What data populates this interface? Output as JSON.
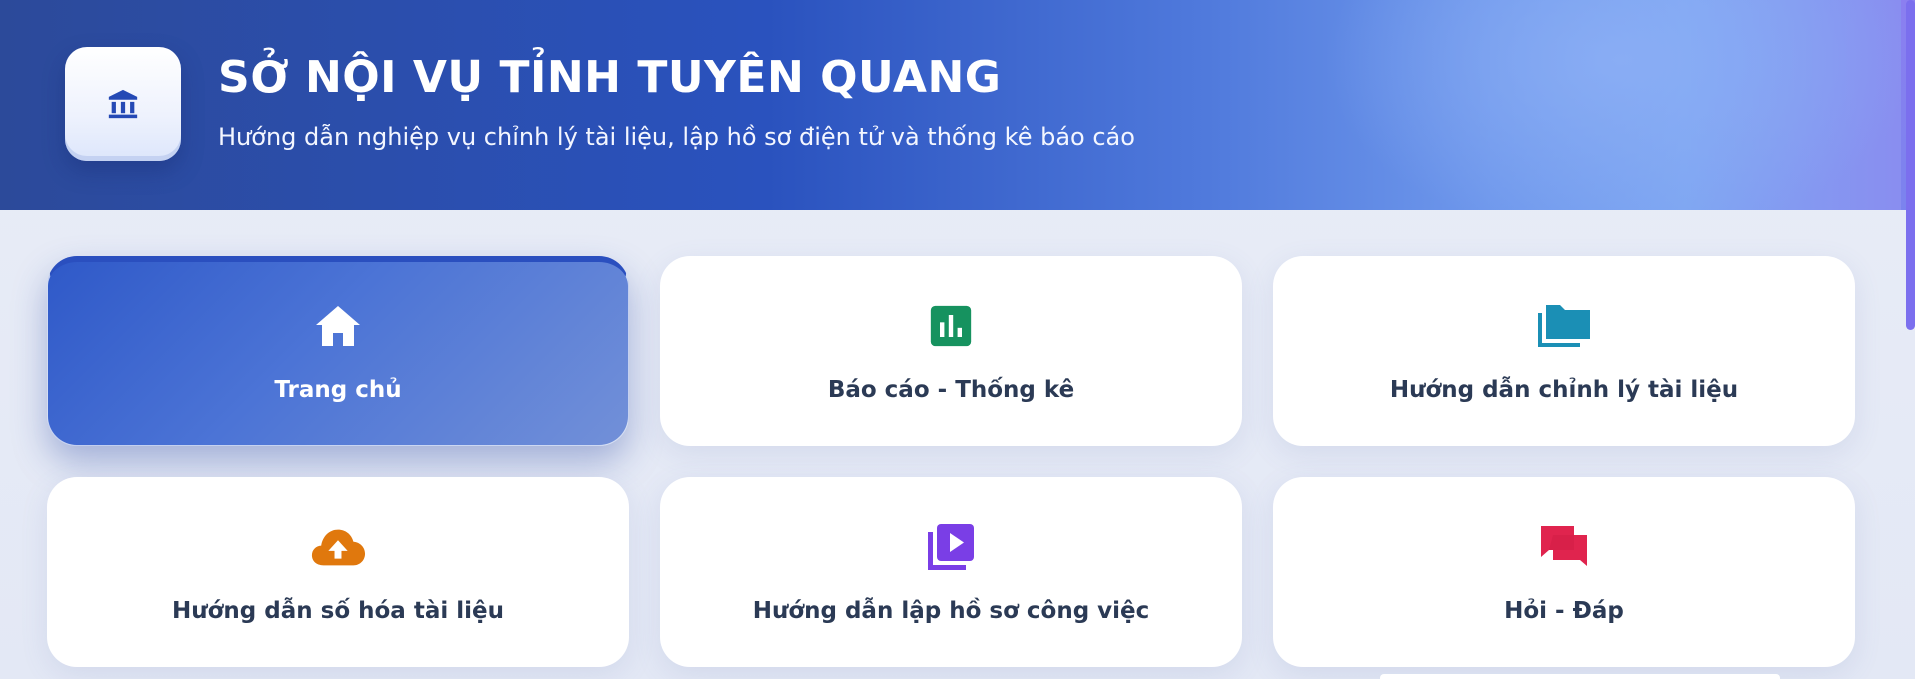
{
  "header": {
    "title": "SỞ NỘI VỤ TỈNH TUYÊN QUANG",
    "subtitle": "Hướng dẫn nghiệp vụ chỉnh lý tài liệu, lập hồ sơ điện tử và thống kê báo cáo",
    "logo_icon": "institution-icon"
  },
  "colors": {
    "primary": "#2a52be",
    "chart_green": "#16925f",
    "folder_teal": "#1b8fb5",
    "cloud_orange": "#e0780d",
    "video_purple": "#7a3ee6",
    "chat_red": "#e0244e",
    "text_dark": "#2b3a55"
  },
  "menu": {
    "items": [
      {
        "label": "Trang chủ",
        "icon": "home-icon",
        "active": true
      },
      {
        "label": "Báo cáo - Thống kê",
        "icon": "bar-chart-icon",
        "active": false
      },
      {
        "label": "Hướng dẫn chỉnh lý tài liệu",
        "icon": "folders-icon",
        "active": false
      },
      {
        "label": "Hướng dẫn số hóa tài liệu",
        "icon": "cloud-upload-icon",
        "active": false
      },
      {
        "label": "Hướng dẫn lập hồ sơ công việc",
        "icon": "video-library-icon",
        "active": false
      },
      {
        "label": "Hỏi - Đáp",
        "icon": "chat-icon",
        "active": false
      }
    ]
  }
}
